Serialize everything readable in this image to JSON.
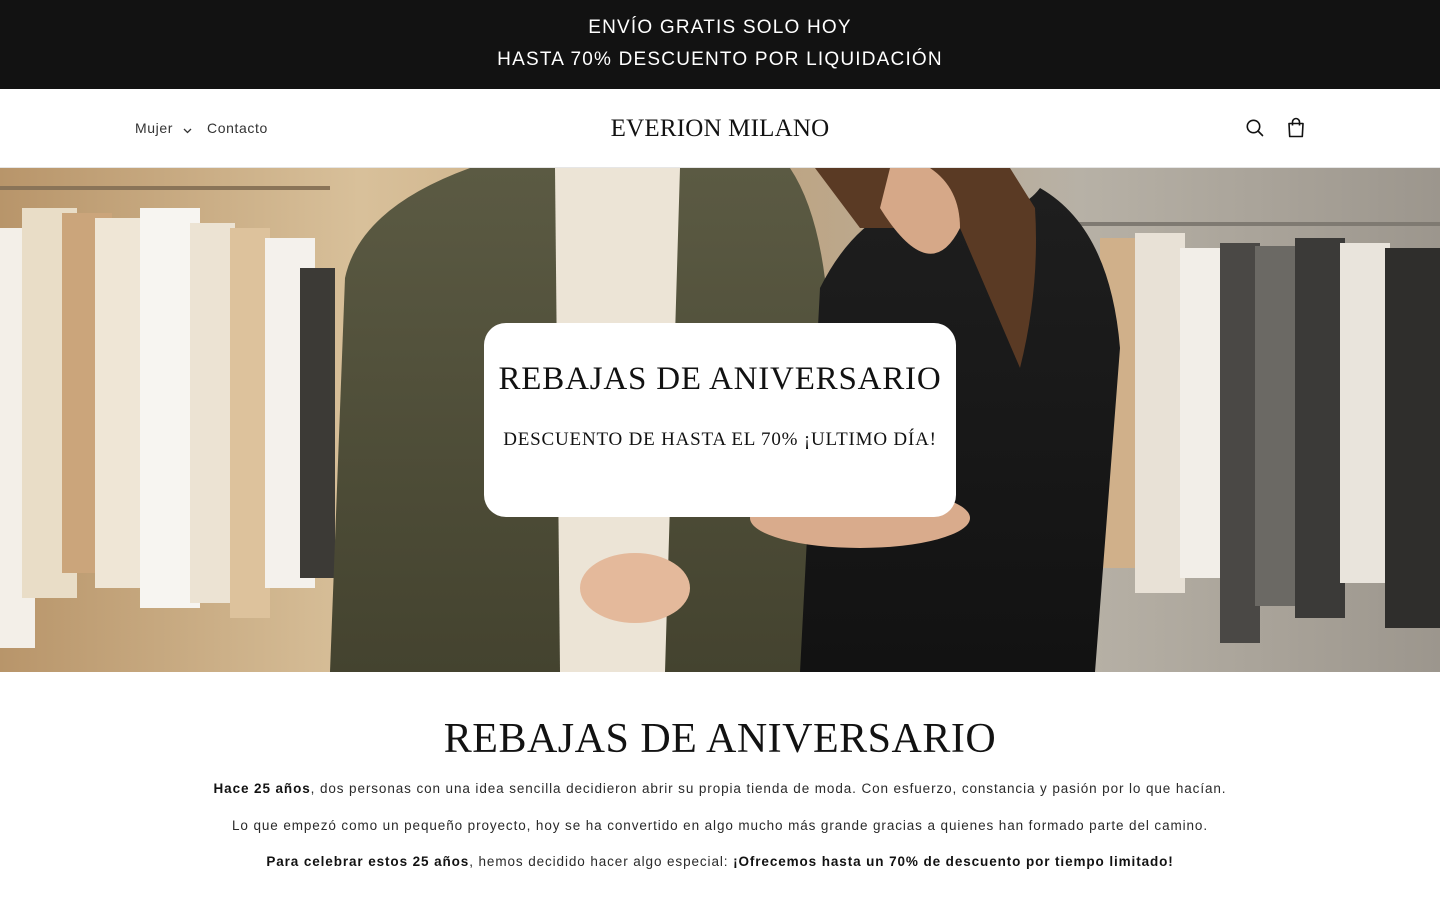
{
  "announcement": {
    "line1": "ENVÍO GRATIS SOLO HOY",
    "line2": "HASTA 70% DESCUENTO POR LIQUIDACIÓN"
  },
  "header": {
    "nav": [
      {
        "label": "Mujer",
        "has_dropdown": true
      },
      {
        "label": "Contacto",
        "has_dropdown": false
      }
    ],
    "logo": "EVERION MILANO",
    "icons": [
      "search-icon",
      "cart-icon"
    ]
  },
  "hero": {
    "image": "couple-in-clothing-store",
    "title": "REBAJAS DE ANIVERSARIO",
    "subtitle": "DESCUENTO DE HASTA EL 70% ¡ULTIMO DÍA!"
  },
  "content": {
    "title": "REBAJAS DE ANIVERSARIO",
    "p1_bold": "Hace 25 años",
    "p1_rest": ", dos personas con una idea sencilla decidieron abrir su propia tienda de moda. Con esfuerzo, constancia y pasión por lo que hacían.",
    "p2": "Lo que empezó como un pequeño proyecto, hoy se ha convertido en algo mucho más grande gracias a quienes han formado parte del camino.",
    "p3_bold": "Para celebrar estos 25 años",
    "p3_mid": ", hemos decidido hacer algo especial: ",
    "p3_bold2": "¡Ofrecemos hasta un 70% de descuento por tiempo limitado!"
  },
  "colors": {
    "announcement_bg": "#121212",
    "text": "#121212",
    "background": "#ffffff"
  }
}
